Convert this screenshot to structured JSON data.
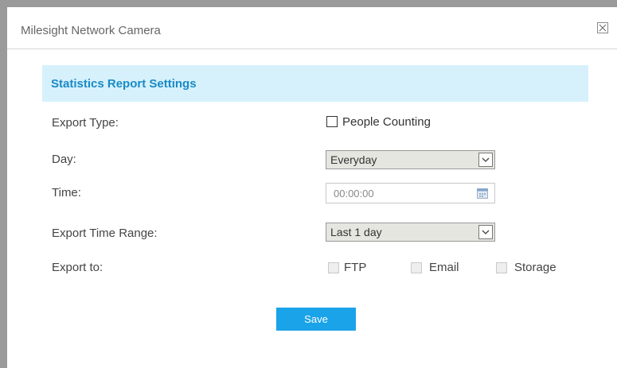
{
  "window": {
    "title": "Milesight Network Camera",
    "close_icon": "close-icon"
  },
  "section": {
    "title": "Statistics Report Settings"
  },
  "labels": {
    "export_type": "Export Type:",
    "day": "Day:",
    "time": "Time:",
    "export_time_range": "Export Time Range:",
    "export_to": "Export to:"
  },
  "export_type": {
    "people_counting_label": "People Counting",
    "checked": false
  },
  "day": {
    "value": "Everyday"
  },
  "time": {
    "value": "00:00:00",
    "icon": "calendar-icon"
  },
  "export_time_range": {
    "value": "Last 1 day"
  },
  "export_to": {
    "ftp": "FTP",
    "email": "Email",
    "storage": "Storage"
  },
  "save_label": "Save",
  "colors": {
    "accent": "#1aa3e8",
    "header_bg": "#d6f1fc",
    "header_text": "#1a8ac6"
  }
}
